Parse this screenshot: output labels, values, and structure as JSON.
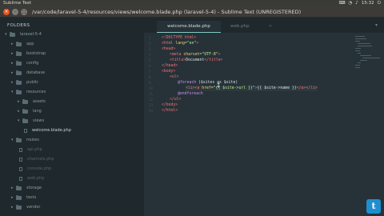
{
  "system_bar": {
    "app_name": "Sublime Text",
    "clock": "15:32"
  },
  "window": {
    "title": "/var/code/laravel-5-4/resources/views/welcome.blade.php (laravel-5-4) - Sublime Text (UNREGISTERED)"
  },
  "sidebar": {
    "header": "FOLDERS",
    "items": [
      {
        "label": "laravel-5-4",
        "kind": "folder-open"
      },
      {
        "label": "app",
        "kind": "folder"
      },
      {
        "label": "bootstrap",
        "kind": "folder"
      },
      {
        "label": "config",
        "kind": "folder"
      },
      {
        "label": "database",
        "kind": "folder"
      },
      {
        "label": "public",
        "kind": "folder"
      },
      {
        "label": "resources",
        "kind": "folder-open"
      },
      {
        "label": "assets",
        "kind": "folder"
      },
      {
        "label": "lang",
        "kind": "folder"
      },
      {
        "label": "views",
        "kind": "folder-open"
      },
      {
        "label": "welcome.blade.php",
        "kind": "file"
      },
      {
        "label": "routes",
        "kind": "folder-open"
      },
      {
        "label": "api.php",
        "kind": "file"
      },
      {
        "label": "channels.php",
        "kind": "file"
      },
      {
        "label": "console.php",
        "kind": "file"
      },
      {
        "label": "web.php",
        "kind": "file"
      },
      {
        "label": "storage",
        "kind": "folder"
      },
      {
        "label": "tests",
        "kind": "folder"
      },
      {
        "label": "vendor",
        "kind": "folder"
      }
    ]
  },
  "tabs": [
    {
      "label": "welcome.blade.php",
      "active": true
    },
    {
      "label": "web.php",
      "close": "×",
      "active": false
    }
  ],
  "tabs_more": "▾",
  "code": {
    "line1": "<!DOCTYPE html>",
    "line2_open": "<html ",
    "line2_attr": "lang",
    "line2_eq": "=",
    "line2_val": "\"en\"",
    "line2_close": ">",
    "line3": "<head>",
    "line4_open": "<meta ",
    "line4_attr": "charset",
    "line4_eq": "=",
    "line4_val": "\"UTF-8\"",
    "line4_close": ">",
    "line5_open": "<title>",
    "line5_text": "Document",
    "line5_close": "</title>",
    "line6": "</head>",
    "line7": "<body>",
    "line8": "<ul>",
    "line9_kw": "@foreach",
    "line9_rest": " ($sites as $site)",
    "line10_open": "<li><a ",
    "line10_attr": "href",
    "line10_eq": "=",
    "line10_val": "\"{{ $site->url }}\"",
    "line10_mid": ">",
    "line10_text": "{{ $site->name }}",
    "line10_close": "</a></li>",
    "line11_kw": "@endforeach",
    "line12": "</ul>",
    "line13": "</body>",
    "line14": "</html>"
  },
  "badge": "t"
}
